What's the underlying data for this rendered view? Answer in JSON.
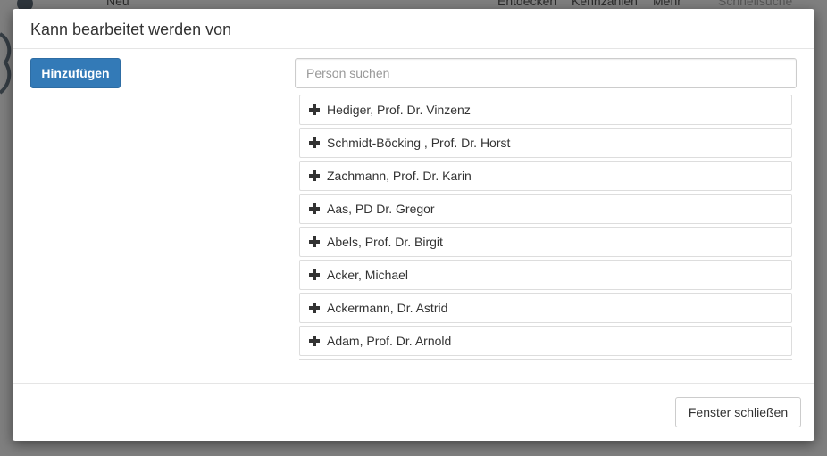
{
  "background": {
    "nav_items": [
      "Neu",
      "Entdecken",
      "Kennzahlen",
      "Mehr",
      "Schnellsuche"
    ]
  },
  "modal": {
    "title": "Kann bearbeitet werden von",
    "add_button_label": "Hinzufügen",
    "search": {
      "value": "",
      "placeholder": "Person suchen"
    },
    "persons": [
      "Hediger, Prof. Dr. Vinzenz",
      "Schmidt-Böcking , Prof. Dr. Horst",
      "Zachmann, Prof. Dr. Karin",
      "Aas, PD Dr. Gregor",
      "Abels, Prof. Dr. Birgit",
      "Acker, Michael",
      "Ackermann, Dr. Astrid",
      "Adam, Prof. Dr. Arnold"
    ],
    "close_button_label": "Fenster schließen"
  }
}
